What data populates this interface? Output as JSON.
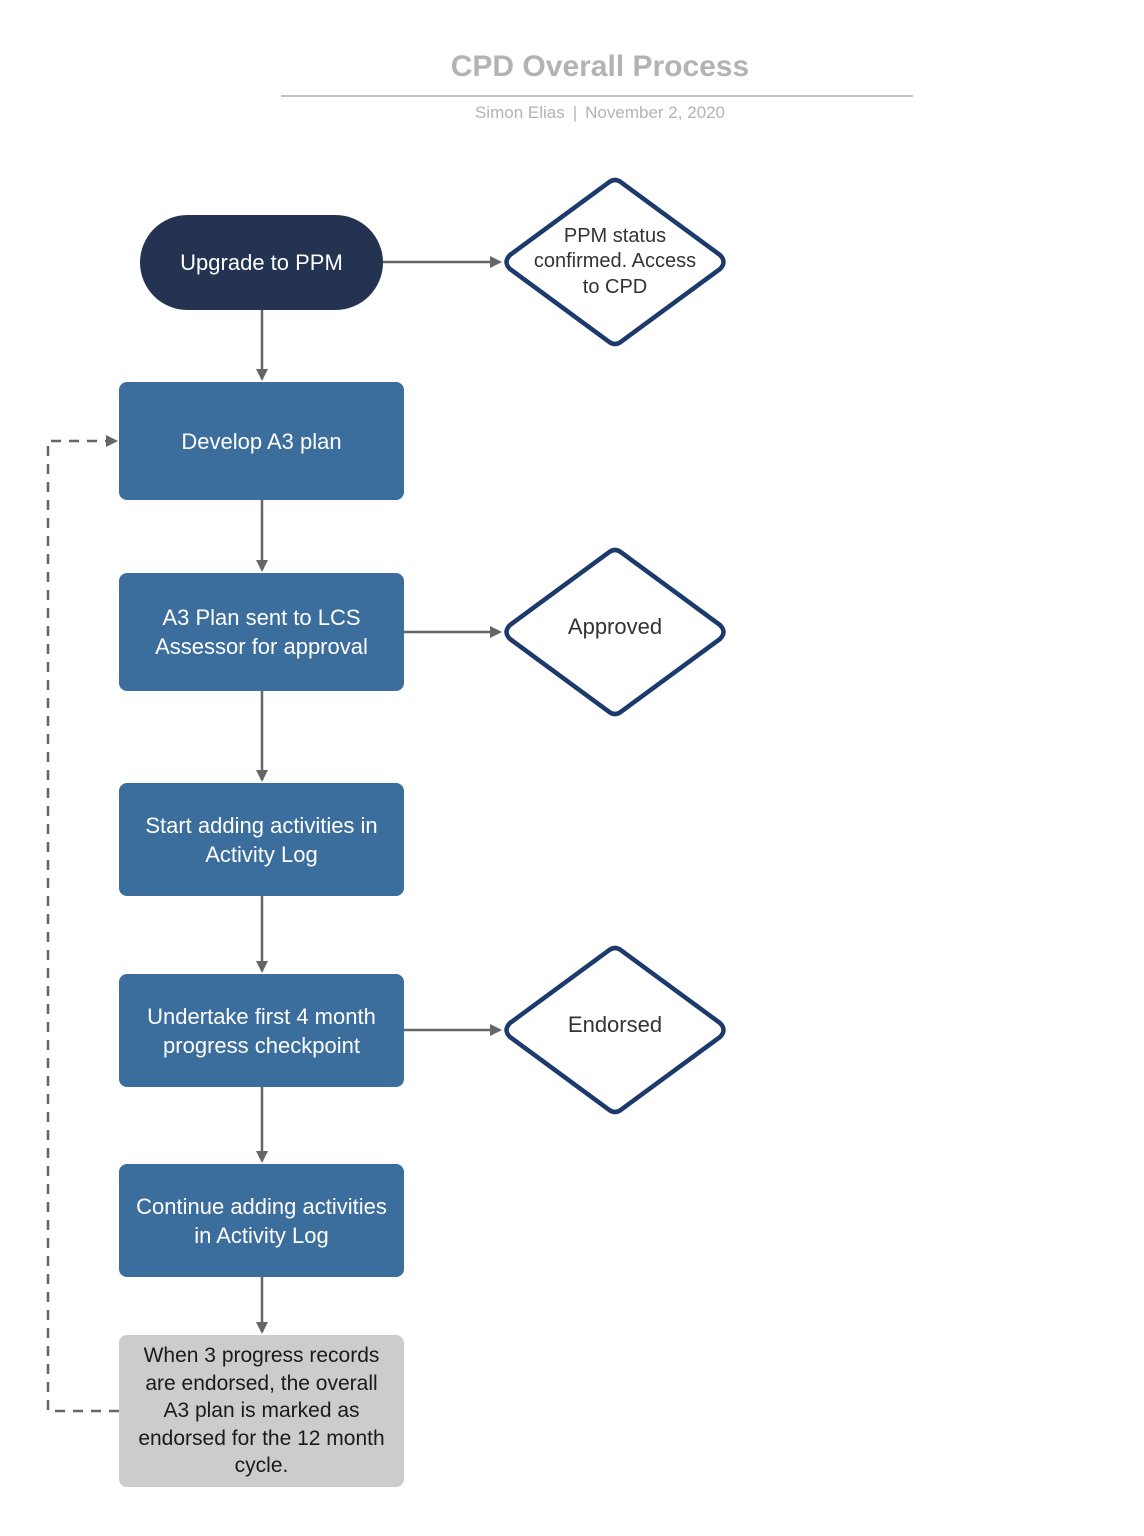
{
  "header": {
    "title": "CPD Overall Process",
    "author": "Simon Elias",
    "separator": "|",
    "date": "November 2, 2020"
  },
  "colors": {
    "terminator_fill": "#233351",
    "process_fill": "#3b6e9d",
    "note_fill": "#cccccc",
    "decision_stroke": "#1c3a6b",
    "connector": "#666666",
    "title_text": "#b3b3b3"
  },
  "nodes": {
    "start": {
      "label": "Upgrade to PPM",
      "shape": "terminator"
    },
    "develop_plan": {
      "label": "Develop A3 plan",
      "shape": "process"
    },
    "plan_sent": {
      "label": "A3 Plan sent to LCS Assessor for approval",
      "shape": "process"
    },
    "start_activities": {
      "label": "Start adding activities in Activity Log",
      "shape": "process"
    },
    "checkpoint": {
      "label": "Undertake first 4 month progress checkpoint",
      "shape": "process"
    },
    "continue_activities": {
      "label": "Continue adding activities in Activity Log",
      "shape": "process"
    },
    "final_note": {
      "label": "When 3 progress records are endorsed, the overall A3 plan is marked as endorsed for the 12 month cycle.",
      "shape": "note"
    }
  },
  "decisions": {
    "ppm_confirmed": {
      "label": "PPM status confirmed. Access to CPD"
    },
    "approved": {
      "label": "Approved"
    },
    "endorsed": {
      "label": "Endorsed"
    }
  },
  "connectors": [
    {
      "from": "start",
      "to": "ppm_confirmed",
      "style": "solid"
    },
    {
      "from": "start",
      "to": "develop_plan",
      "style": "solid"
    },
    {
      "from": "develop_plan",
      "to": "plan_sent",
      "style": "solid"
    },
    {
      "from": "plan_sent",
      "to": "approved",
      "style": "solid"
    },
    {
      "from": "plan_sent",
      "to": "start_activities",
      "style": "solid"
    },
    {
      "from": "start_activities",
      "to": "checkpoint",
      "style": "solid"
    },
    {
      "from": "checkpoint",
      "to": "endorsed",
      "style": "solid"
    },
    {
      "from": "checkpoint",
      "to": "continue_activities",
      "style": "solid"
    },
    {
      "from": "continue_activities",
      "to": "final_note",
      "style": "solid"
    },
    {
      "from": "final_note",
      "to": "develop_plan",
      "style": "dashed"
    }
  ]
}
